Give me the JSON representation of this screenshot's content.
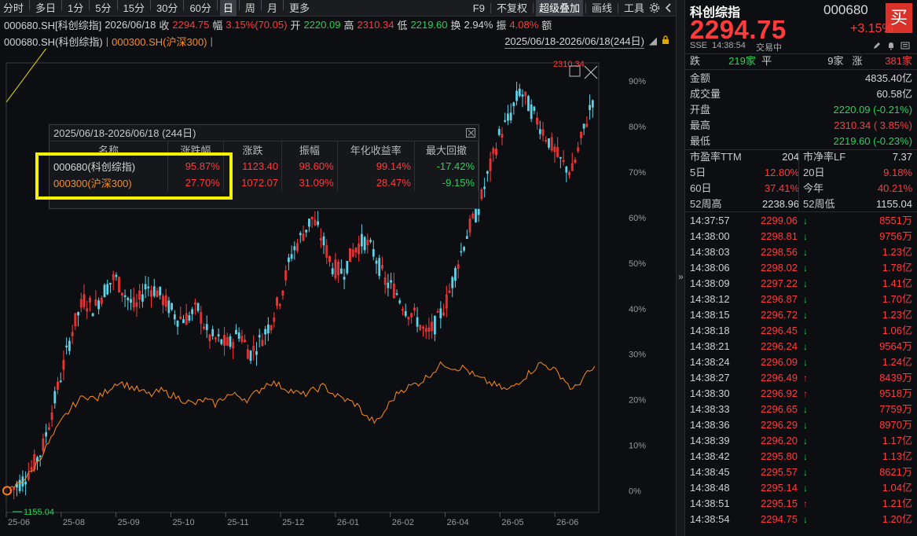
{
  "toolbar": {
    "periods": [
      "分时",
      "多日",
      "1分",
      "5分",
      "15分",
      "30分",
      "60分",
      "日",
      "周",
      "月",
      "更多"
    ],
    "selected_index": 7,
    "right_items": [
      "F9",
      "不复权",
      "超级叠加",
      "画线",
      "工具"
    ],
    "highlighted_right_index": 2
  },
  "info": {
    "symbol": "000680.SH[科创综指]",
    "date": "2026/06/18",
    "close_label": "收",
    "close_value": "2294.75",
    "amp_label": "幅",
    "amp_value": "3.15%(70.05)",
    "open_label": "开",
    "open_value": "2220.09",
    "high_label": "高",
    "high_value": "2310.34",
    "low_label": "低",
    "low_value": "2219.60",
    "turnover_label": "换",
    "turnover_value": "2.94%",
    "swing_label": "振",
    "swing_value": "4.08%",
    "amount_label": "额"
  },
  "legend": {
    "main": "000680.SH(科创综指)",
    "overlay": "000300.SH(沪深300)",
    "range": "2025/06/18-2026/06/18(244日)"
  },
  "chart_data": {
    "type": "candlestick+line",
    "x_ticks": [
      "25-06",
      "25-08",
      "25-09",
      "25-10",
      "25-11",
      "25-12",
      "26-01",
      "26-02",
      "26-04",
      "26-05",
      "26-06"
    ],
    "y_ticks": [
      "0%",
      "10%",
      "20%",
      "30%",
      "40%",
      "50%",
      "60%",
      "70%",
      "80%",
      "90%"
    ],
    "y_unit": "%",
    "ylim": [
      -2,
      94
    ],
    "max_label": "2310.34",
    "min_label": "1155.04",
    "series": [
      {
        "name": "000680.SH(科创综指)",
        "kind": "candles",
        "pct_path": [
          0,
          2,
          5,
          9,
          18,
          27,
          36,
          42,
          40,
          44,
          47,
          43,
          40,
          45,
          44,
          41,
          38,
          38,
          40,
          34,
          33,
          32,
          35,
          30,
          33,
          37,
          43,
          52,
          56,
          60,
          55,
          49,
          48,
          53,
          55,
          52,
          46,
          44,
          40,
          38,
          34,
          37,
          42,
          50,
          57,
          62,
          70,
          78,
          82,
          88,
          84,
          80,
          76,
          72,
          70,
          78,
          86
        ]
      },
      {
        "name": "000300.SH(沪深300)",
        "kind": "line",
        "pct_path": [
          0,
          2,
          4,
          8,
          12,
          16,
          19,
          21,
          20,
          22,
          24,
          23,
          22,
          21,
          22,
          21,
          20,
          19,
          20,
          19,
          21,
          21,
          20,
          22,
          24,
          23,
          22,
          21,
          22,
          23,
          21,
          20,
          19,
          16,
          15,
          19,
          22,
          23,
          24,
          26,
          28,
          27,
          27,
          25,
          24,
          23,
          22,
          24,
          26,
          28,
          27,
          25,
          22,
          25,
          27
        ]
      }
    ]
  },
  "popup": {
    "title": "2025/06/18-2026/06/18 (244日)",
    "headers": [
      "名称",
      "涨跌幅",
      "涨跌",
      "振幅",
      "年化收益率",
      "最大回撤"
    ],
    "rows": [
      [
        "000680(科创综指)",
        "95.87%",
        "1123.40",
        "98.60%",
        "99.14%",
        "-17.42%"
      ],
      [
        "000300(沪深300)",
        "27.70%",
        "1072.07",
        "31.09%",
        "28.47%",
        "-9.15%"
      ]
    ]
  },
  "quote": {
    "name": "科创综指",
    "code": "000680",
    "price": "2294.75",
    "change_pct": "+3.15%",
    "buy_label": "买",
    "exchange": "SSE",
    "time": "14:38:54",
    "status": "交易中",
    "breadth": {
      "down_label": "跌",
      "down": "219家",
      "flat_label": "平",
      "flat": "9家",
      "up_label": "涨",
      "up": "381家"
    },
    "stats": [
      {
        "label": "金额",
        "value": "4835.40亿",
        "color": "#d8d8d8"
      },
      {
        "label": "成交量",
        "value": "60.58亿",
        "color": "#d8d8d8"
      },
      {
        "label": "开盘",
        "value": "2220.09 (-0.21%)",
        "color": "#2bd05a"
      },
      {
        "label": "最高",
        "value": "2310.34 ( 3.85%)",
        "color": "#ff3b3b"
      },
      {
        "label": "最低",
        "value": "2219.60 (-0.23%)",
        "color": "#2bd05a"
      }
    ],
    "grid": [
      [
        {
          "label": "市盈率TTM",
          "value": "204",
          "color": "#d8d8d8"
        },
        {
          "label": "市净率LF",
          "value": "7.37",
          "color": "#d8d8d8"
        }
      ],
      [
        {
          "label": "5日",
          "value": "12.80%",
          "color": "#ff3b3b"
        },
        {
          "label": "20日",
          "value": "9.18%",
          "color": "#ff3b3b"
        }
      ],
      [
        {
          "label": "60日",
          "value": "37.41%",
          "color": "#ff3b3b"
        },
        {
          "label": "今年",
          "value": "40.21%",
          "color": "#ff3b3b"
        }
      ],
      [
        {
          "label": "52周高",
          "value": "2238.96",
          "color": "#d8d8d8"
        },
        {
          "label": "52周低",
          "value": "1155.04",
          "color": "#d8d8d8"
        }
      ]
    ]
  },
  "ticks": [
    {
      "time": "14:37:57",
      "price": "2299.06",
      "dir": "down",
      "vol": "8551万"
    },
    {
      "time": "14:38:00",
      "price": "2298.81",
      "dir": "down",
      "vol": "9756万"
    },
    {
      "time": "14:38:03",
      "price": "2298.56",
      "dir": "down",
      "vol": "1.23亿"
    },
    {
      "time": "14:38:06",
      "price": "2298.02",
      "dir": "down",
      "vol": "1.78亿"
    },
    {
      "time": "14:38:09",
      "price": "2297.22",
      "dir": "down",
      "vol": "1.41亿"
    },
    {
      "time": "14:38:12",
      "price": "2296.87",
      "dir": "down",
      "vol": "1.70亿"
    },
    {
      "time": "14:38:15",
      "price": "2296.72",
      "dir": "down",
      "vol": "1.23亿"
    },
    {
      "time": "14:38:18",
      "price": "2296.45",
      "dir": "down",
      "vol": "1.06亿"
    },
    {
      "time": "14:38:21",
      "price": "2296.24",
      "dir": "down",
      "vol": "9564万"
    },
    {
      "time": "14:38:24",
      "price": "2296.09",
      "dir": "down",
      "vol": "1.24亿"
    },
    {
      "time": "14:38:27",
      "price": "2296.49",
      "dir": "up",
      "vol": "8439万"
    },
    {
      "time": "14:38:30",
      "price": "2296.92",
      "dir": "up",
      "vol": "9518万"
    },
    {
      "time": "14:38:33",
      "price": "2296.65",
      "dir": "down",
      "vol": "7759万"
    },
    {
      "time": "14:38:36",
      "price": "2296.29",
      "dir": "down",
      "vol": "8970万"
    },
    {
      "time": "14:38:39",
      "price": "2296.20",
      "dir": "down",
      "vol": "1.17亿"
    },
    {
      "time": "14:38:42",
      "price": "2295.80",
      "dir": "down",
      "vol": "1.13亿"
    },
    {
      "time": "14:38:45",
      "price": "2295.57",
      "dir": "down",
      "vol": "8621万"
    },
    {
      "time": "14:38:48",
      "price": "2295.14",
      "dir": "down",
      "vol": "1.04亿"
    },
    {
      "time": "14:38:51",
      "price": "2295.15",
      "dir": "up",
      "vol": "1.21亿"
    },
    {
      "time": "14:38:54",
      "price": "2294.75",
      "dir": "down",
      "vol": "1.20亿"
    }
  ],
  "colors": {
    "up": "#ff3b3b",
    "down": "#2bd05a",
    "overlay": "#ff8c1a",
    "highlight": "#f7f300",
    "flat_candle": "#5fd3e6"
  }
}
